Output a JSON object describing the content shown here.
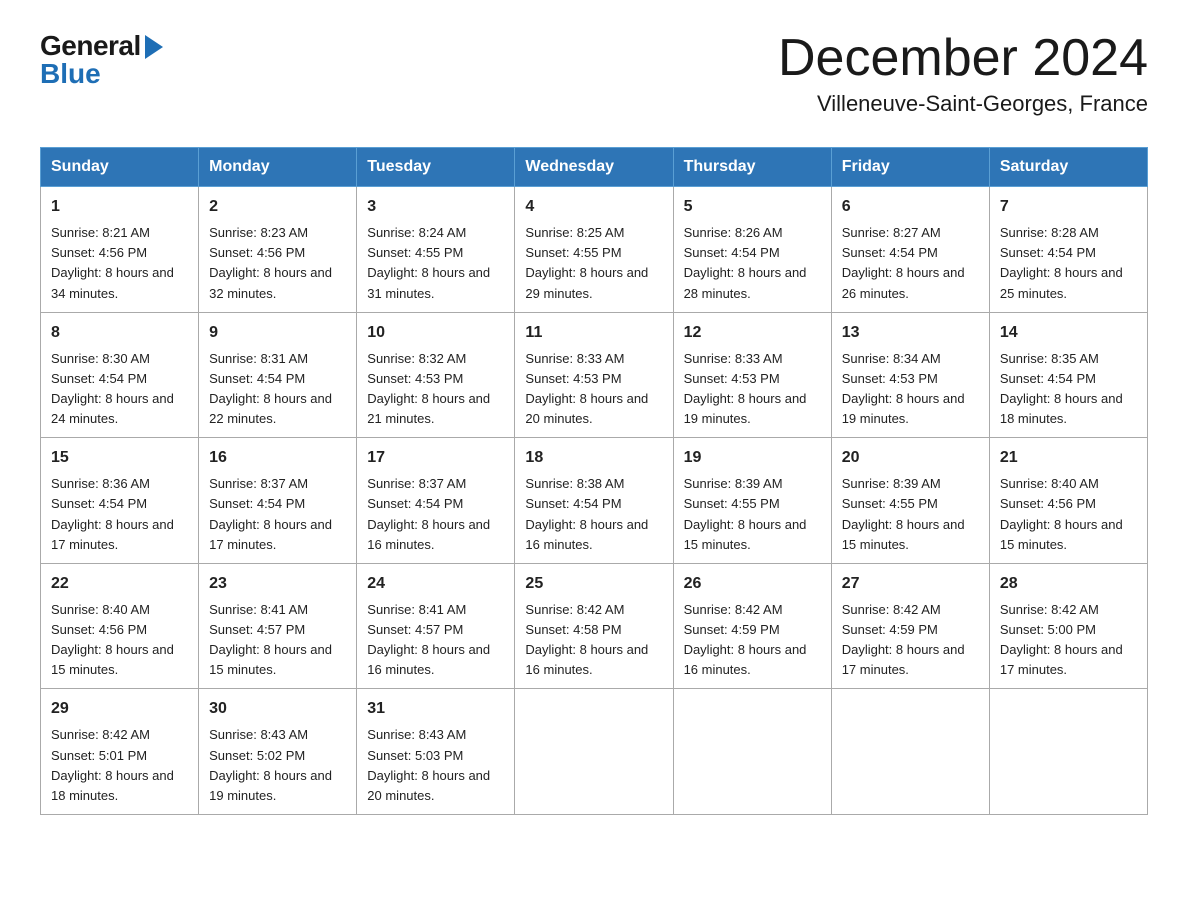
{
  "header": {
    "logo_general": "General",
    "logo_blue": "Blue",
    "title": "December 2024",
    "location": "Villeneuve-Saint-Georges, France"
  },
  "days_of_week": [
    "Sunday",
    "Monday",
    "Tuesday",
    "Wednesday",
    "Thursday",
    "Friday",
    "Saturday"
  ],
  "weeks": [
    [
      {
        "day": "1",
        "sunrise": "8:21 AM",
        "sunset": "4:56 PM",
        "daylight": "8 hours and 34 minutes."
      },
      {
        "day": "2",
        "sunrise": "8:23 AM",
        "sunset": "4:56 PM",
        "daylight": "8 hours and 32 minutes."
      },
      {
        "day": "3",
        "sunrise": "8:24 AM",
        "sunset": "4:55 PM",
        "daylight": "8 hours and 31 minutes."
      },
      {
        "day": "4",
        "sunrise": "8:25 AM",
        "sunset": "4:55 PM",
        "daylight": "8 hours and 29 minutes."
      },
      {
        "day": "5",
        "sunrise": "8:26 AM",
        "sunset": "4:54 PM",
        "daylight": "8 hours and 28 minutes."
      },
      {
        "day": "6",
        "sunrise": "8:27 AM",
        "sunset": "4:54 PM",
        "daylight": "8 hours and 26 minutes."
      },
      {
        "day": "7",
        "sunrise": "8:28 AM",
        "sunset": "4:54 PM",
        "daylight": "8 hours and 25 minutes."
      }
    ],
    [
      {
        "day": "8",
        "sunrise": "8:30 AM",
        "sunset": "4:54 PM",
        "daylight": "8 hours and 24 minutes."
      },
      {
        "day": "9",
        "sunrise": "8:31 AM",
        "sunset": "4:54 PM",
        "daylight": "8 hours and 22 minutes."
      },
      {
        "day": "10",
        "sunrise": "8:32 AM",
        "sunset": "4:53 PM",
        "daylight": "8 hours and 21 minutes."
      },
      {
        "day": "11",
        "sunrise": "8:33 AM",
        "sunset": "4:53 PM",
        "daylight": "8 hours and 20 minutes."
      },
      {
        "day": "12",
        "sunrise": "8:33 AM",
        "sunset": "4:53 PM",
        "daylight": "8 hours and 19 minutes."
      },
      {
        "day": "13",
        "sunrise": "8:34 AM",
        "sunset": "4:53 PM",
        "daylight": "8 hours and 19 minutes."
      },
      {
        "day": "14",
        "sunrise": "8:35 AM",
        "sunset": "4:54 PM",
        "daylight": "8 hours and 18 minutes."
      }
    ],
    [
      {
        "day": "15",
        "sunrise": "8:36 AM",
        "sunset": "4:54 PM",
        "daylight": "8 hours and 17 minutes."
      },
      {
        "day": "16",
        "sunrise": "8:37 AM",
        "sunset": "4:54 PM",
        "daylight": "8 hours and 17 minutes."
      },
      {
        "day": "17",
        "sunrise": "8:37 AM",
        "sunset": "4:54 PM",
        "daylight": "8 hours and 16 minutes."
      },
      {
        "day": "18",
        "sunrise": "8:38 AM",
        "sunset": "4:54 PM",
        "daylight": "8 hours and 16 minutes."
      },
      {
        "day": "19",
        "sunrise": "8:39 AM",
        "sunset": "4:55 PM",
        "daylight": "8 hours and 15 minutes."
      },
      {
        "day": "20",
        "sunrise": "8:39 AM",
        "sunset": "4:55 PM",
        "daylight": "8 hours and 15 minutes."
      },
      {
        "day": "21",
        "sunrise": "8:40 AM",
        "sunset": "4:56 PM",
        "daylight": "8 hours and 15 minutes."
      }
    ],
    [
      {
        "day": "22",
        "sunrise": "8:40 AM",
        "sunset": "4:56 PM",
        "daylight": "8 hours and 15 minutes."
      },
      {
        "day": "23",
        "sunrise": "8:41 AM",
        "sunset": "4:57 PM",
        "daylight": "8 hours and 15 minutes."
      },
      {
        "day": "24",
        "sunrise": "8:41 AM",
        "sunset": "4:57 PM",
        "daylight": "8 hours and 16 minutes."
      },
      {
        "day": "25",
        "sunrise": "8:42 AM",
        "sunset": "4:58 PM",
        "daylight": "8 hours and 16 minutes."
      },
      {
        "day": "26",
        "sunrise": "8:42 AM",
        "sunset": "4:59 PM",
        "daylight": "8 hours and 16 minutes."
      },
      {
        "day": "27",
        "sunrise": "8:42 AM",
        "sunset": "4:59 PM",
        "daylight": "8 hours and 17 minutes."
      },
      {
        "day": "28",
        "sunrise": "8:42 AM",
        "sunset": "5:00 PM",
        "daylight": "8 hours and 17 minutes."
      }
    ],
    [
      {
        "day": "29",
        "sunrise": "8:42 AM",
        "sunset": "5:01 PM",
        "daylight": "8 hours and 18 minutes."
      },
      {
        "day": "30",
        "sunrise": "8:43 AM",
        "sunset": "5:02 PM",
        "daylight": "8 hours and 19 minutes."
      },
      {
        "day": "31",
        "sunrise": "8:43 AM",
        "sunset": "5:03 PM",
        "daylight": "8 hours and 20 minutes."
      },
      null,
      null,
      null,
      null
    ]
  ]
}
